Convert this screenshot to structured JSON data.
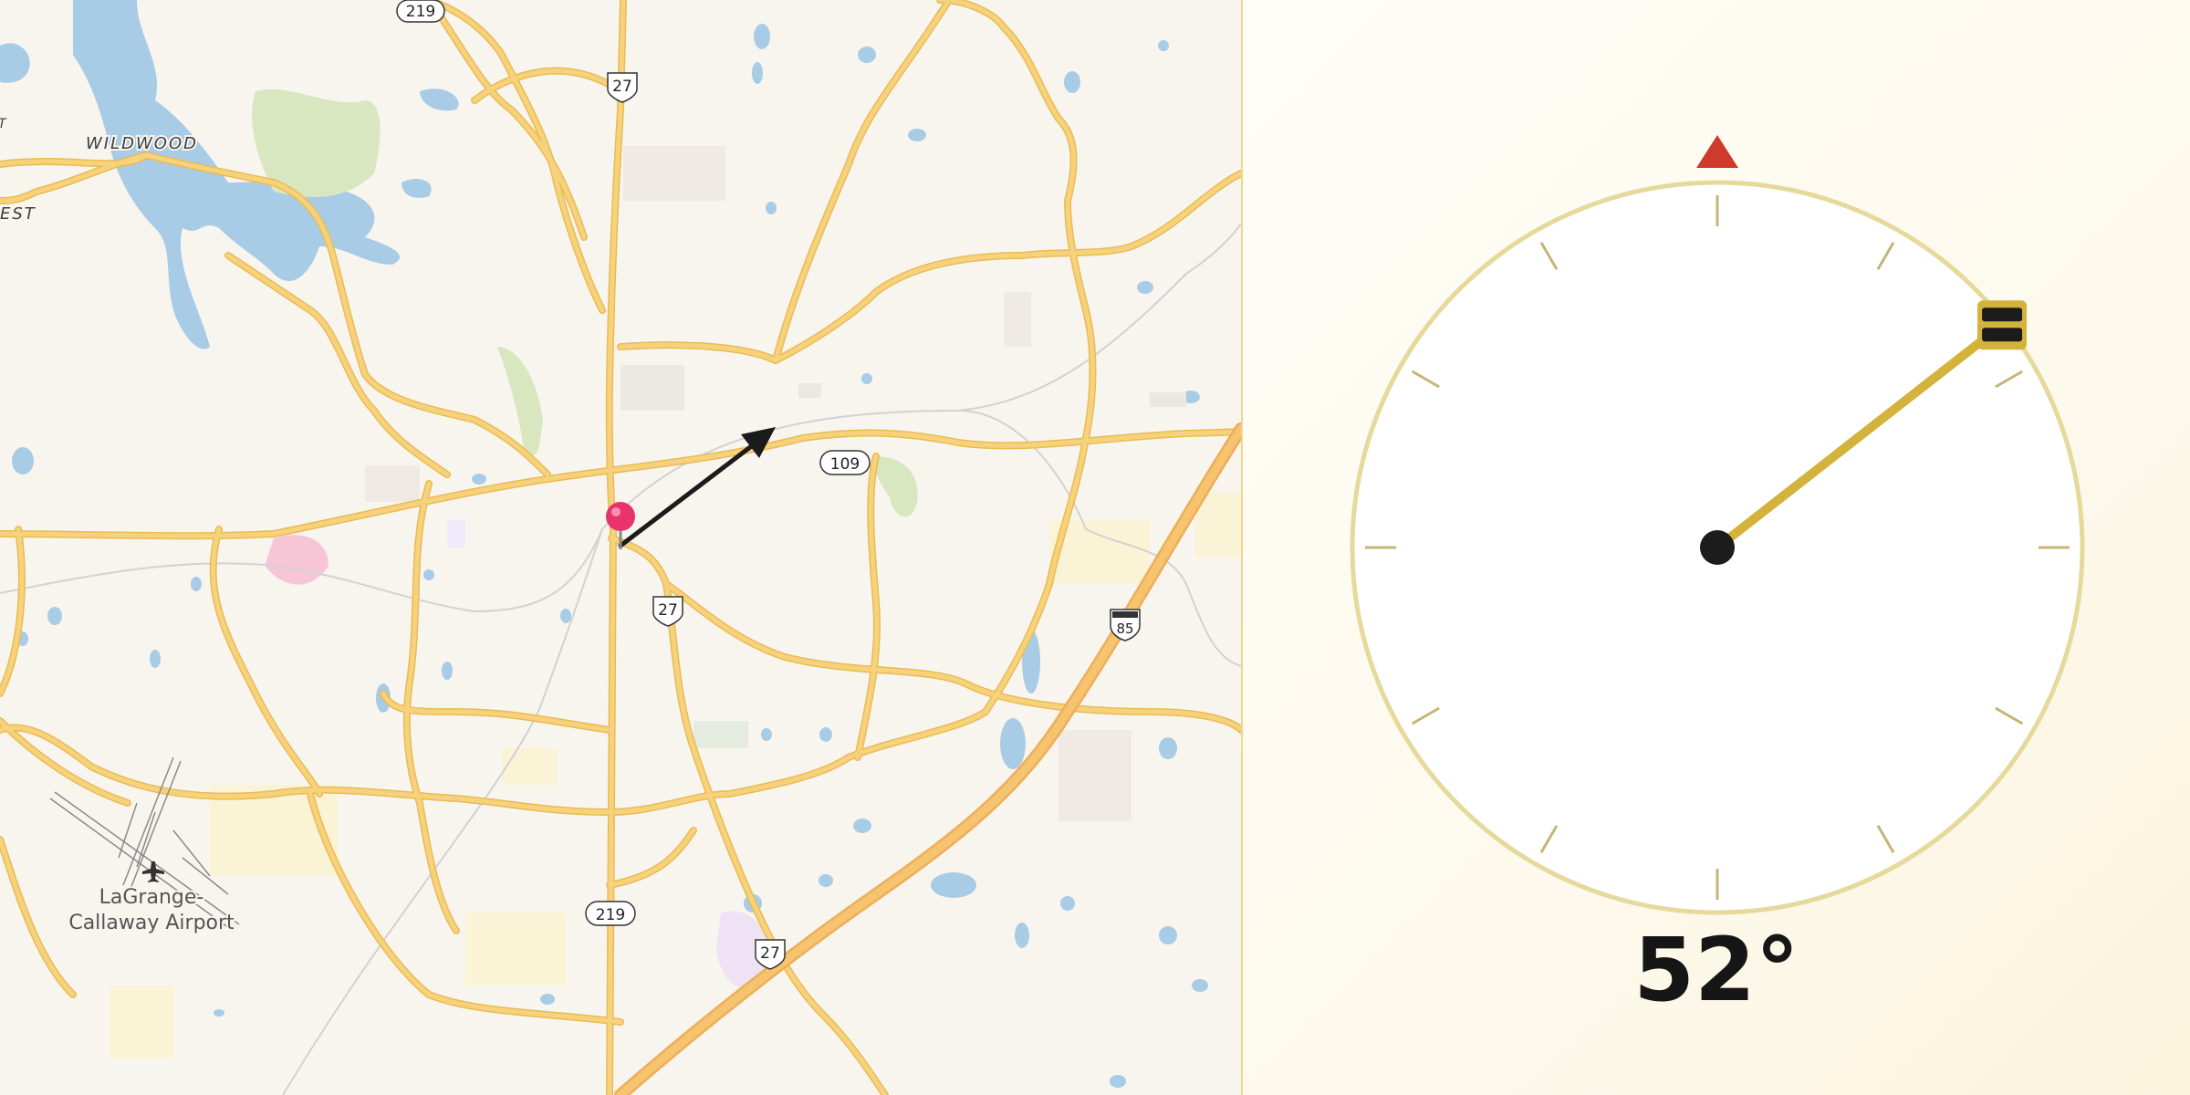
{
  "map": {
    "place_labels": {
      "wildwood": "WILDWOOD",
      "forest_partial": "EST",
      "partial_left": "T",
      "airport_line1": "LaGrange-",
      "airport_line2": "Callaway Airport"
    },
    "road_shields": {
      "us27_north": "27",
      "us27_south": "27",
      "us27_center": "27",
      "ga219_top": "219",
      "ga219_bottom": "219",
      "ga109": "109",
      "i85": "85"
    },
    "colors": {
      "land": "#f8f5ef",
      "water": "#a8cce6",
      "park": "#d9e7c1",
      "road": "#f7d27c",
      "road_casing": "#e9bb55",
      "interstate": "#f6c36e",
      "pin": "#e8336e",
      "arrow": "#1b1b1b"
    }
  },
  "compass": {
    "heading_text": "52°",
    "heading_value": 52,
    "north_marker_icon": "north-triangle-icon",
    "colors": {
      "ring": "#e6d99c",
      "tick": "#c7b474",
      "needle": "#d4b33c",
      "north_marker": "#cf3a2c",
      "handle": "#1c1c1c",
      "hub": "#1c1c1c"
    }
  }
}
